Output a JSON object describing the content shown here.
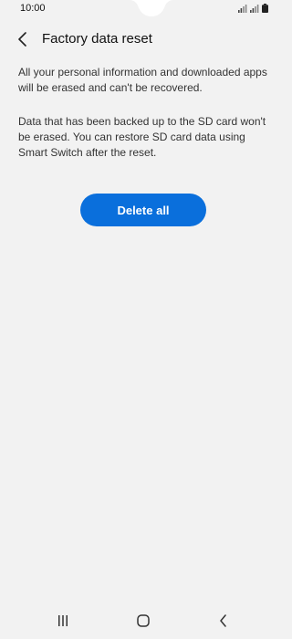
{
  "status_bar": {
    "time": "10:00"
  },
  "header": {
    "title": "Factory data reset"
  },
  "content": {
    "paragraph_1": "All your personal information and downloaded apps will be erased and can't be recovered.",
    "paragraph_2": "Data that has been backed up to the SD card won't be erased. You can restore SD card data using Smart Switch after the reset."
  },
  "actions": {
    "delete_all_label": "Delete all"
  },
  "colors": {
    "accent": "#0a6fdc",
    "background": "#f2f2f2"
  },
  "navigation": {
    "recent_icon": "recent-apps-icon",
    "home_icon": "home-icon",
    "back_icon": "back-icon"
  }
}
